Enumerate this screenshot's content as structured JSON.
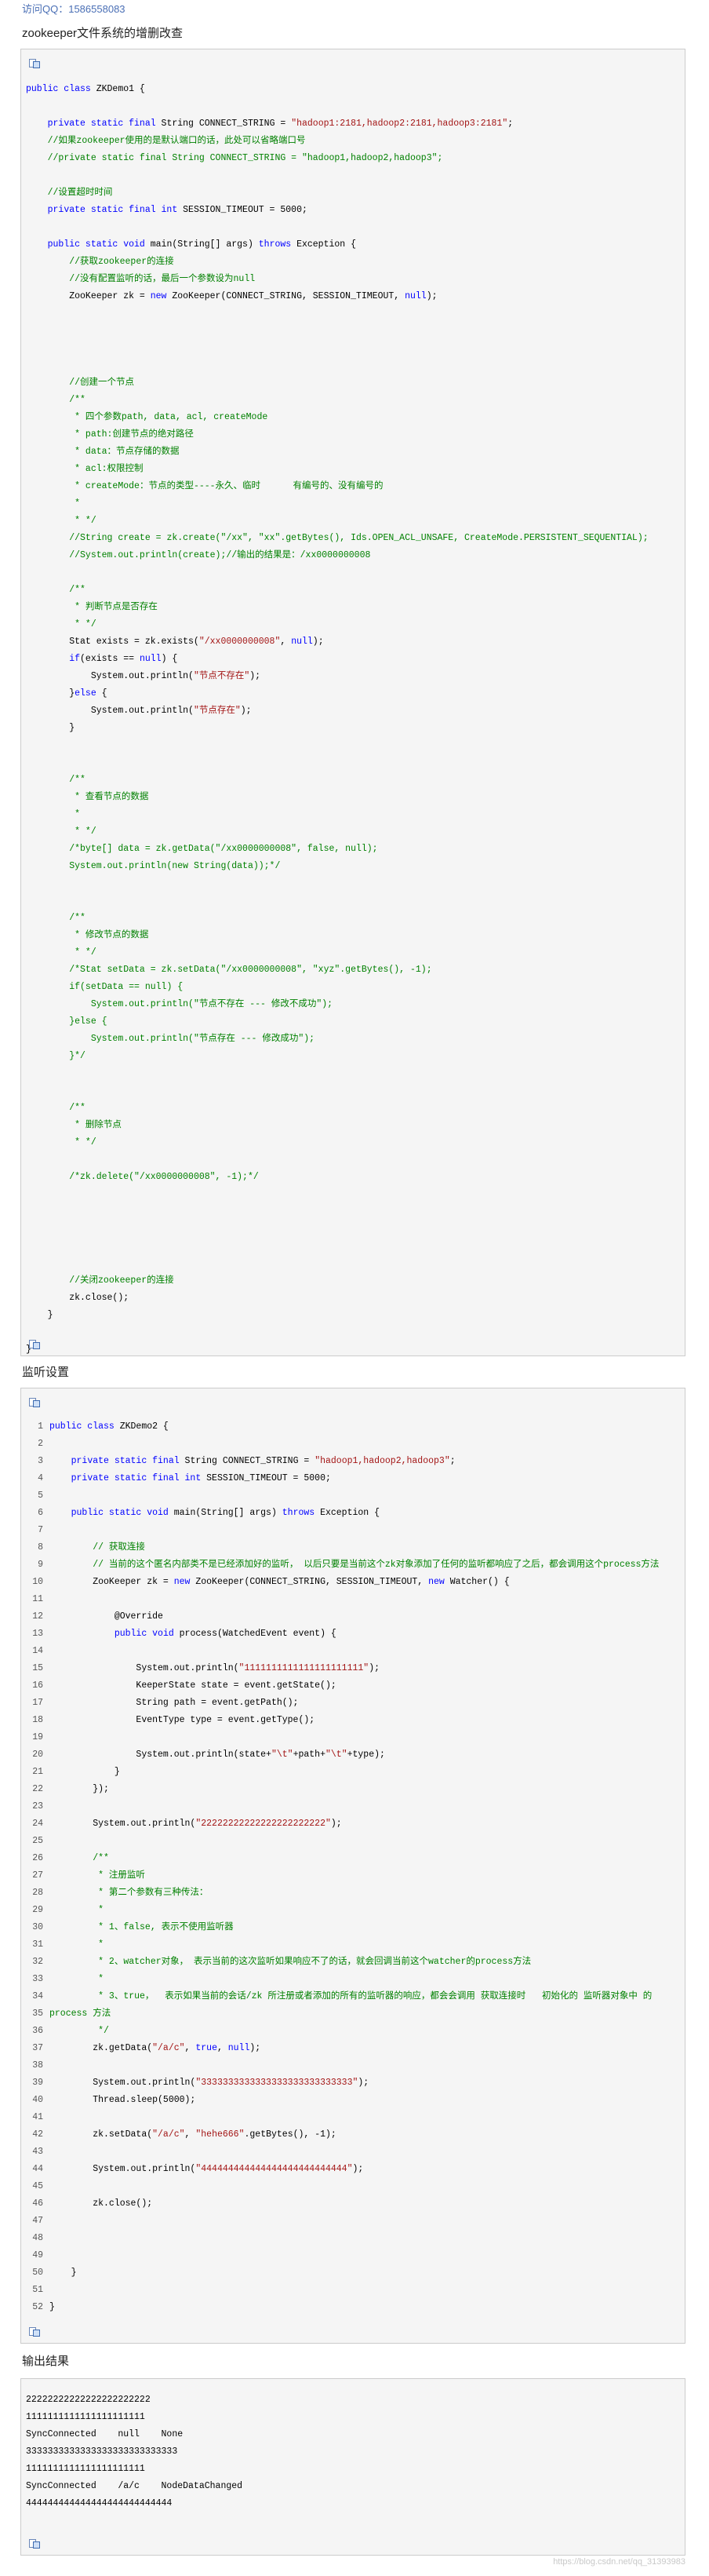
{
  "qq_label": "访问QQ：1586558083",
  "section1": {
    "title": "zookeeper文件系统的增删改查",
    "lines": [
      [
        [
          "kw",
          "public class "
        ],
        [
          "",
          "ZKDemo1 {"
        ]
      ],
      [
        [
          "",
          ""
        ]
      ],
      [
        [
          "",
          "    "
        ],
        [
          "kw",
          "private static final "
        ],
        [
          "",
          "String CONNECT_STRING = "
        ],
        [
          "st",
          "\"hadoop1:2181,hadoop2:2181,hadoop3:2181\""
        ],
        [
          "",
          ";"
        ]
      ],
      [
        [
          "",
          "    "
        ],
        [
          "cm",
          "//如果zookeeper使用的是默认端口的话，此处可以省略端口号"
        ]
      ],
      [
        [
          "",
          "    "
        ],
        [
          "cm",
          "//private static final String CONNECT_STRING = \"hadoop1,hadoop2,hadoop3\";"
        ]
      ],
      [
        [
          "",
          ""
        ]
      ],
      [
        [
          "",
          "    "
        ],
        [
          "cm",
          "//设置超时时间"
        ]
      ],
      [
        [
          "",
          "    "
        ],
        [
          "kw",
          "private static final int "
        ],
        [
          "",
          "SESSION_TIMEOUT = 5000;"
        ]
      ],
      [
        [
          "",
          ""
        ]
      ],
      [
        [
          "",
          "    "
        ],
        [
          "kw",
          "public static void "
        ],
        [
          "",
          "main(String[] args) "
        ],
        [
          "kw",
          "throws "
        ],
        [
          "",
          "Exception {"
        ]
      ],
      [
        [
          "",
          "        "
        ],
        [
          "cm",
          "//获取zookeeper的连接"
        ]
      ],
      [
        [
          "",
          "        "
        ],
        [
          "cm",
          "//没有配置监听的话，最后一个参数设为null"
        ]
      ],
      [
        [
          "",
          "        ZooKeeper zk = "
        ],
        [
          "kw",
          "new "
        ],
        [
          "",
          "ZooKeeper(CONNECT_STRING, SESSION_TIMEOUT, "
        ],
        [
          "kw",
          "null"
        ],
        [
          "",
          ");"
        ]
      ],
      [
        [
          "",
          ""
        ]
      ],
      [
        [
          "",
          ""
        ]
      ],
      [
        [
          "",
          ""
        ]
      ],
      [
        [
          "",
          ""
        ]
      ],
      [
        [
          "",
          "        "
        ],
        [
          "cm",
          "//创建一个节点"
        ]
      ],
      [
        [
          "",
          "        "
        ],
        [
          "cm",
          "/**"
        ]
      ],
      [
        [
          "",
          "         "
        ],
        [
          "cm",
          "* 四个参数path, data, acl, createMode"
        ]
      ],
      [
        [
          "",
          "         "
        ],
        [
          "cm",
          "* path:创建节点的绝对路径"
        ]
      ],
      [
        [
          "",
          "         "
        ],
        [
          "cm",
          "* data：节点存储的数据"
        ]
      ],
      [
        [
          "",
          "         "
        ],
        [
          "cm",
          "* acl:权限控制"
        ]
      ],
      [
        [
          "",
          "         "
        ],
        [
          "cm",
          "* createMode：节点的类型----永久、临时      有编号的、没有编号的"
        ]
      ],
      [
        [
          "",
          "         "
        ],
        [
          "cm",
          "*"
        ]
      ],
      [
        [
          "",
          "         "
        ],
        [
          "cm",
          "* */"
        ]
      ],
      [
        [
          "",
          "        "
        ],
        [
          "cm",
          "//String create = zk.create(\"/xx\", \"xx\".getBytes(), Ids.OPEN_ACL_UNSAFE, CreateMode.PERSISTENT_SEQUENTIAL);"
        ]
      ],
      [
        [
          "",
          "        "
        ],
        [
          "cm",
          "//System.out.println(create);//输出的结果是：/xx0000000008"
        ]
      ],
      [
        [
          "",
          ""
        ]
      ],
      [
        [
          "",
          "        "
        ],
        [
          "cm",
          "/**"
        ]
      ],
      [
        [
          "",
          "         "
        ],
        [
          "cm",
          "* 判断节点是否存在"
        ]
      ],
      [
        [
          "",
          "         "
        ],
        [
          "cm",
          "* */"
        ]
      ],
      [
        [
          "",
          "        Stat exists = zk.exists("
        ],
        [
          "st",
          "\"/xx0000000008\""
        ],
        [
          "",
          ", "
        ],
        [
          "kw",
          "null"
        ],
        [
          "",
          ");"
        ]
      ],
      [
        [
          "",
          "        "
        ],
        [
          "kw",
          "if"
        ],
        [
          "",
          "(exists == "
        ],
        [
          "kw",
          "null"
        ],
        [
          "",
          ") {"
        ]
      ],
      [
        [
          "",
          "            System.out.println("
        ],
        [
          "st",
          "\"节点不存在\""
        ],
        [
          "",
          ");"
        ]
      ],
      [
        [
          "",
          "        }"
        ],
        [
          "kw",
          "else "
        ],
        [
          "",
          "{"
        ]
      ],
      [
        [
          "",
          "            System.out.println("
        ],
        [
          "st",
          "\"节点存在\""
        ],
        [
          "",
          ");"
        ]
      ],
      [
        [
          "",
          "        }"
        ]
      ],
      [
        [
          "",
          ""
        ]
      ],
      [
        [
          "",
          ""
        ]
      ],
      [
        [
          "",
          "        "
        ],
        [
          "cm",
          "/**"
        ]
      ],
      [
        [
          "",
          "         "
        ],
        [
          "cm",
          "* 查看节点的数据"
        ]
      ],
      [
        [
          "",
          "         "
        ],
        [
          "cm",
          "*"
        ]
      ],
      [
        [
          "",
          "         "
        ],
        [
          "cm",
          "* */"
        ]
      ],
      [
        [
          "",
          "        "
        ],
        [
          "cm",
          "/*byte[] data = zk.getData(\"/xx0000000008\", false, null);"
        ]
      ],
      [
        [
          "",
          "        "
        ],
        [
          "cm",
          "System.out.println(new String(data));*/"
        ]
      ],
      [
        [
          "",
          ""
        ]
      ],
      [
        [
          "",
          ""
        ]
      ],
      [
        [
          "",
          "        "
        ],
        [
          "cm",
          "/**"
        ]
      ],
      [
        [
          "",
          "         "
        ],
        [
          "cm",
          "* 修改节点的数据"
        ]
      ],
      [
        [
          "",
          "         "
        ],
        [
          "cm",
          "* */"
        ]
      ],
      [
        [
          "",
          "        "
        ],
        [
          "cm",
          "/*Stat setData = zk.setData(\"/xx0000000008\", \"xyz\".getBytes(), -1);"
        ]
      ],
      [
        [
          "",
          "        "
        ],
        [
          "cm",
          "if(setData == null) {"
        ]
      ],
      [
        [
          "",
          "            "
        ],
        [
          "cm",
          "System.out.println(\"节点不存在 --- 修改不成功\");"
        ]
      ],
      [
        [
          "",
          "        "
        ],
        [
          "cm",
          "}else {"
        ]
      ],
      [
        [
          "",
          "            "
        ],
        [
          "cm",
          "System.out.println(\"节点存在 --- 修改成功\");"
        ]
      ],
      [
        [
          "",
          "        "
        ],
        [
          "cm",
          "}*/"
        ]
      ],
      [
        [
          "",
          ""
        ]
      ],
      [
        [
          "",
          ""
        ]
      ],
      [
        [
          "",
          "        "
        ],
        [
          "cm",
          "/**"
        ]
      ],
      [
        [
          "",
          "         "
        ],
        [
          "cm",
          "* 删除节点"
        ]
      ],
      [
        [
          "",
          "         "
        ],
        [
          "cm",
          "* */"
        ]
      ],
      [
        [
          "",
          ""
        ]
      ],
      [
        [
          "",
          "        "
        ],
        [
          "cm",
          "/*zk.delete(\"/xx0000000008\", -1);*/"
        ]
      ],
      [
        [
          "",
          ""
        ]
      ],
      [
        [
          "",
          ""
        ]
      ],
      [
        [
          "",
          ""
        ]
      ],
      [
        [
          "",
          ""
        ]
      ],
      [
        [
          "",
          ""
        ]
      ],
      [
        [
          "",
          "        "
        ],
        [
          "cm",
          "//关闭zookeeper的连接"
        ]
      ],
      [
        [
          "",
          "        zk.close();"
        ]
      ],
      [
        [
          "",
          "    }"
        ]
      ],
      [
        [
          "",
          ""
        ]
      ],
      [
        [
          "",
          "}"
        ]
      ]
    ]
  },
  "section2": {
    "title": "监听设置",
    "lines": [
      [
        [
          "kw",
          "public class "
        ],
        [
          "",
          "ZKDemo2 {"
        ]
      ],
      [
        [
          "",
          ""
        ]
      ],
      [
        [
          "",
          "    "
        ],
        [
          "kw",
          "private static final "
        ],
        [
          "",
          "String CONNECT_STRING = "
        ],
        [
          "st",
          "\"hadoop1,hadoop2,hadoop3\""
        ],
        [
          "",
          ";"
        ]
      ],
      [
        [
          "",
          "    "
        ],
        [
          "kw",
          "private static final int "
        ],
        [
          "",
          "SESSION_TIMEOUT = 5000;"
        ]
      ],
      [
        [
          "",
          ""
        ]
      ],
      [
        [
          "",
          "    "
        ],
        [
          "kw",
          "public static void "
        ],
        [
          "",
          "main(String[] args) "
        ],
        [
          "kw",
          "throws "
        ],
        [
          "",
          "Exception {"
        ]
      ],
      [
        [
          "",
          ""
        ]
      ],
      [
        [
          "",
          "        "
        ],
        [
          "cm",
          "// 获取连接"
        ]
      ],
      [
        [
          "",
          "        "
        ],
        [
          "cm",
          "// 当前的这个匿名内部类不是已经添加好的监听， 以后只要是当前这个zk对象添加了任何的监听都响应了之后，都会调用这个process方法"
        ]
      ],
      [
        [
          "",
          "        ZooKeeper zk = "
        ],
        [
          "kw",
          "new "
        ],
        [
          "",
          "ZooKeeper(CONNECT_STRING, SESSION_TIMEOUT, "
        ],
        [
          "kw",
          "new "
        ],
        [
          "",
          "Watcher() {"
        ]
      ],
      [
        [
          "",
          ""
        ]
      ],
      [
        [
          "",
          "            @Override"
        ]
      ],
      [
        [
          "",
          "            "
        ],
        [
          "kw",
          "public void "
        ],
        [
          "",
          "process(WatchedEvent event) {"
        ]
      ],
      [
        [
          "",
          ""
        ]
      ],
      [
        [
          "",
          "                System.out.println("
        ],
        [
          "st",
          "\"1111111111111111111111\""
        ],
        [
          "",
          ");"
        ]
      ],
      [
        [
          "",
          "                KeeperState state = event.getState();"
        ]
      ],
      [
        [
          "",
          "                String path = event.getPath();"
        ]
      ],
      [
        [
          "",
          "                EventType type = event.getType();"
        ]
      ],
      [
        [
          "",
          ""
        ]
      ],
      [
        [
          "",
          "                System.out.println(state+"
        ],
        [
          "st",
          "\"\\t\""
        ],
        [
          "",
          "+path+"
        ],
        [
          "st",
          "\"\\t\""
        ],
        [
          "",
          "+type);"
        ]
      ],
      [
        [
          "",
          "            }"
        ]
      ],
      [
        [
          "",
          "        });"
        ]
      ],
      [
        [
          "",
          ""
        ]
      ],
      [
        [
          "",
          "        System.out.println("
        ],
        [
          "st",
          "\"22222222222222222222222\""
        ],
        [
          "",
          ");"
        ]
      ],
      [
        [
          "",
          ""
        ]
      ],
      [
        [
          "",
          "        "
        ],
        [
          "cm",
          "/**"
        ]
      ],
      [
        [
          "",
          "         "
        ],
        [
          "cm",
          "* 注册监听"
        ]
      ],
      [
        [
          "",
          "         "
        ],
        [
          "cm",
          "* 第二个参数有三种传法："
        ]
      ],
      [
        [
          "",
          "         "
        ],
        [
          "cm",
          "*"
        ]
      ],
      [
        [
          "",
          "         "
        ],
        [
          "cm",
          "* 1、false, 表示不使用监听器"
        ]
      ],
      [
        [
          "",
          "         "
        ],
        [
          "cm",
          "*"
        ]
      ],
      [
        [
          "",
          "         "
        ],
        [
          "cm",
          "* 2、watcher对象， 表示当前的这次监听如果响应不了的话，就会回调当前这个watcher的process方法"
        ]
      ],
      [
        [
          "",
          "         "
        ],
        [
          "cm",
          "*"
        ]
      ],
      [
        [
          "",
          "         "
        ],
        [
          "cm",
          "* 3、true，  表示如果当前的会话/zk 所注册或者添加的所有的监听器的响应，都会会调用 获取连接时   初始化的 监听器对象中 的"
        ]
      ],
      [
        [
          "cm",
          "process 方法"
        ]
      ],
      [
        [
          "",
          "         "
        ],
        [
          "cm",
          "*/"
        ]
      ],
      [
        [
          "",
          "        zk.getData("
        ],
        [
          "st",
          "\"/a/c\""
        ],
        [
          "",
          ", "
        ],
        [
          "kw",
          "true"
        ],
        [
          "",
          ", "
        ],
        [
          "kw",
          "null"
        ],
        [
          "",
          ");"
        ]
      ],
      [
        [
          "",
          ""
        ]
      ],
      [
        [
          "",
          "        System.out.println("
        ],
        [
          "st",
          "\"3333333333333333333333333333\""
        ],
        [
          "",
          ");"
        ]
      ],
      [
        [
          "",
          "        Thread.sleep(5000);"
        ]
      ],
      [
        [
          "",
          ""
        ]
      ],
      [
        [
          "",
          "        zk.setData("
        ],
        [
          "st",
          "\"/a/c\""
        ],
        [
          "",
          ", "
        ],
        [
          "st",
          "\"hehe666\""
        ],
        [
          "",
          ".getBytes(), -1);"
        ]
      ],
      [
        [
          "",
          ""
        ]
      ],
      [
        [
          "",
          "        System.out.println("
        ],
        [
          "st",
          "\"444444444444444444444444444\""
        ],
        [
          "",
          ");"
        ]
      ],
      [
        [
          "",
          ""
        ]
      ],
      [
        [
          "",
          "        zk.close();"
        ]
      ],
      [
        [
          "",
          ""
        ]
      ],
      [
        [
          "",
          ""
        ]
      ],
      [
        [
          "",
          ""
        ]
      ],
      [
        [
          "",
          "    }"
        ]
      ],
      [
        [
          "",
          ""
        ]
      ],
      [
        [
          "",
          "}"
        ]
      ]
    ]
  },
  "section3": {
    "title": "输出结果",
    "lines": [
      "22222222222222222222222",
      "1111111111111111111111",
      "SyncConnected    null    None",
      "3333333333333333333333333333",
      "1111111111111111111111",
      "SyncConnected    /a/c    NodeDataChanged",
      "444444444444444444444444444"
    ]
  },
  "watermark": "https://blog.csdn.net/qq_31393983"
}
